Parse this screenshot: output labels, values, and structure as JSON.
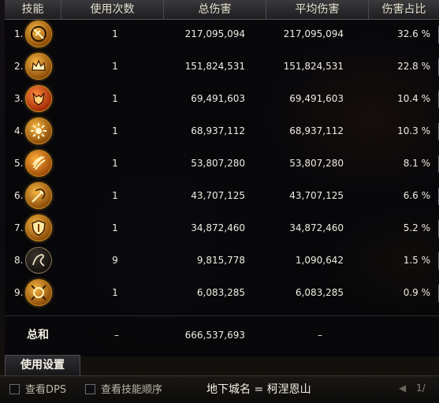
{
  "header": {
    "skill": "技能",
    "uses": "使用次数",
    "total": "总伤害",
    "avg": "平均伤害",
    "pct": "伤害占比"
  },
  "rows": [
    {
      "index": "1.",
      "icon": "shield-rune-icon",
      "uses": "1",
      "total": "217,095,094",
      "avg": "217,095,094",
      "pct": "32.6  %"
    },
    {
      "index": "2.",
      "icon": "crown-icon",
      "uses": "1",
      "total": "151,824,531",
      "avg": "151,824,531",
      "pct": "22.8  %"
    },
    {
      "index": "3.",
      "icon": "fox-demon-icon",
      "uses": "1",
      "total": "69,491,603",
      "avg": "69,491,603",
      "pct": "10.4  %"
    },
    {
      "index": "4.",
      "icon": "sun-sigil-icon",
      "uses": "1",
      "total": "68,937,112",
      "avg": "68,937,112",
      "pct": "10.3  %"
    },
    {
      "index": "5.",
      "icon": "claw-slash-icon",
      "uses": "1",
      "total": "53,807,280",
      "avg": "53,807,280",
      "pct": "8.1  %"
    },
    {
      "index": "6.",
      "icon": "spiral-sword-icon",
      "uses": "1",
      "total": "43,707,125",
      "avg": "43,707,125",
      "pct": "6.6  %"
    },
    {
      "index": "7.",
      "icon": "guard-shield-icon",
      "uses": "1",
      "total": "34,872,460",
      "avg": "34,872,460",
      "pct": "5.2  %"
    },
    {
      "index": "8.",
      "icon": "whip-icon",
      "uses": "9",
      "total": "9,815,778",
      "avg": "1,090,642",
      "pct": "1.5  %"
    },
    {
      "index": "9.",
      "icon": "ring-burst-icon",
      "uses": "1",
      "total": "6,083,285",
      "avg": "6,083,285",
      "pct": "0.9  %"
    }
  ],
  "sum": {
    "label": "总和",
    "uses": "–",
    "total": "666,537,693",
    "avg": "–"
  },
  "settings_tab": "使用设置",
  "bottom": {
    "view_dps": "查看DPS",
    "view_order": "查看技能顺序",
    "location": "地下城名 = 柯涅恩山",
    "page": "1/"
  },
  "colors": {
    "icon_gold": "#f6b743",
    "icon_dark": "#8c4b08",
    "header_text": "#e2dccb"
  }
}
